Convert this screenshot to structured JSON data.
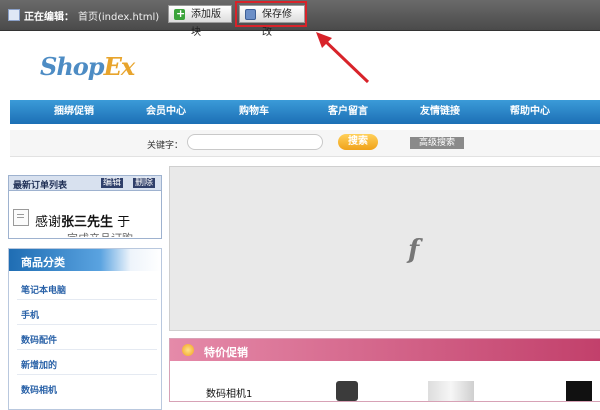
{
  "toolbar": {
    "editing_label": "正在编辑：",
    "editing_page": "首页(index.html)",
    "add_block_label": "添加版块",
    "save_label": "保存修改"
  },
  "logo": {
    "part1": "Shop",
    "part2": "Ex"
  },
  "nav": {
    "items": [
      {
        "label": "捆绑促销"
      },
      {
        "label": "会员中心"
      },
      {
        "label": "购物车"
      },
      {
        "label": "客户留言"
      },
      {
        "label": "友情链接"
      },
      {
        "label": "帮助中心"
      }
    ]
  },
  "search": {
    "keyword_label": "关键字：",
    "search_button": "搜索",
    "advanced_button": "高级搜索"
  },
  "orders": {
    "title": "最新订单列表",
    "edit_label": "编辑",
    "delete_label": "删除",
    "text_prefix": "感谢",
    "text_name": "张三先生",
    "text_suffix": " 于",
    "text_cutoff": "完成产品订购"
  },
  "categories": {
    "title": "商品分类",
    "items": [
      {
        "label": "笔记本电脑"
      },
      {
        "label": "手机"
      },
      {
        "label": "数码配件"
      },
      {
        "label": "新增加的"
      },
      {
        "label": "数码相机"
      }
    ]
  },
  "flash": {
    "icon": "flash-player-icon",
    "glyph": "f"
  },
  "promo": {
    "title": "特价促销",
    "product_name": "数码相机1"
  },
  "colors": {
    "toolbar_bg": "#4a4a4a",
    "nav_blue": "#1c6fb5",
    "highlight_red": "#d8232a",
    "promo_pink": "#c2406b",
    "search_orange": "#f0a21a"
  }
}
